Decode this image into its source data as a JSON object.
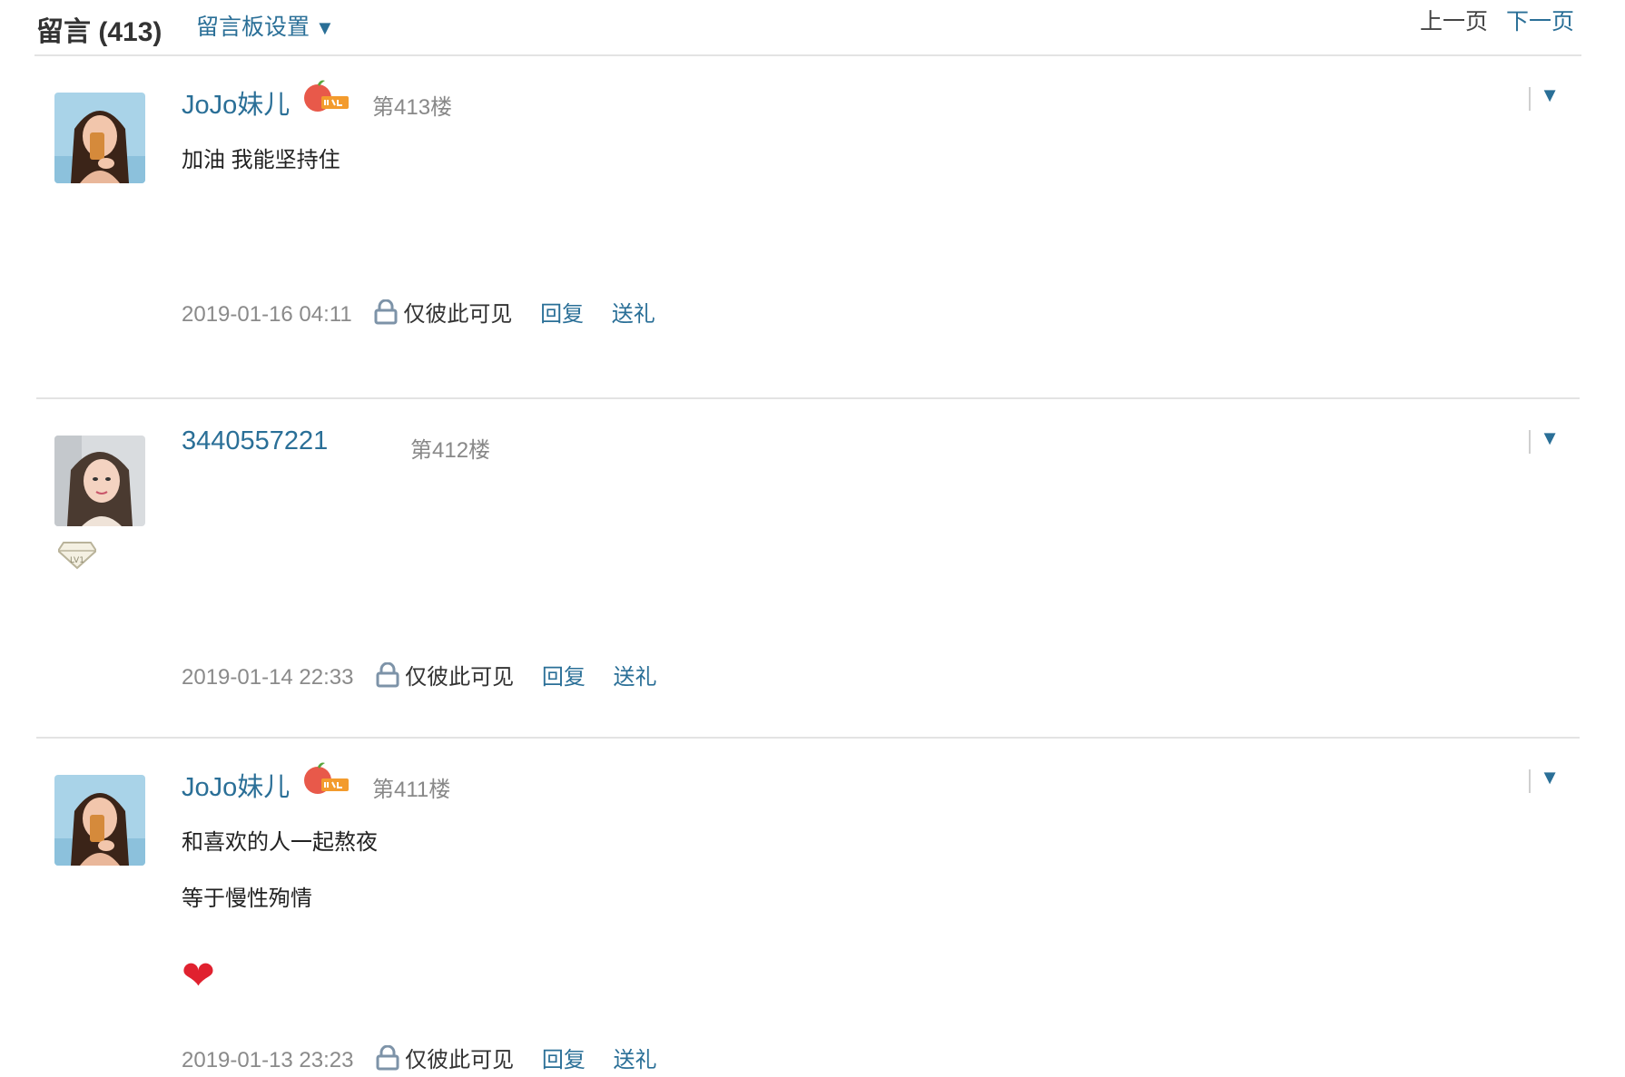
{
  "header": {
    "title": "留言 (413)",
    "settings_label": "留言板设置",
    "settings_arrow": "▼",
    "prev_page": "上一页",
    "next_page": "下一页"
  },
  "posts": [
    {
      "author": "JoJo妹儿",
      "floor": "第413楼",
      "lines": [
        "加油 我能坚持住"
      ],
      "time": "2019-01-16 04:11",
      "privacy": "仅彼此可见",
      "reply": "回复",
      "gift": "送礼",
      "menu": "▼"
    },
    {
      "author": "3440557221",
      "floor": "第412楼",
      "lines": [],
      "time": "2019-01-14 22:33",
      "privacy": "仅彼此可见",
      "reply": "回复",
      "gift": "送礼",
      "menu": "▼"
    },
    {
      "author": "JoJo妹儿",
      "floor": "第411楼",
      "lines": [
        "和喜欢的人一起熬夜",
        "等于慢性殉情"
      ],
      "emoji": "❤",
      "time": "2019-01-13 23:23",
      "privacy": "仅彼此可见",
      "reply": "回复",
      "gift": "送礼",
      "menu": "▼"
    }
  ],
  "colors": {
    "link": "#2a6f97",
    "muted": "#8a8a8a",
    "divider": "#e3e3e3",
    "heart": "#e0212f"
  }
}
